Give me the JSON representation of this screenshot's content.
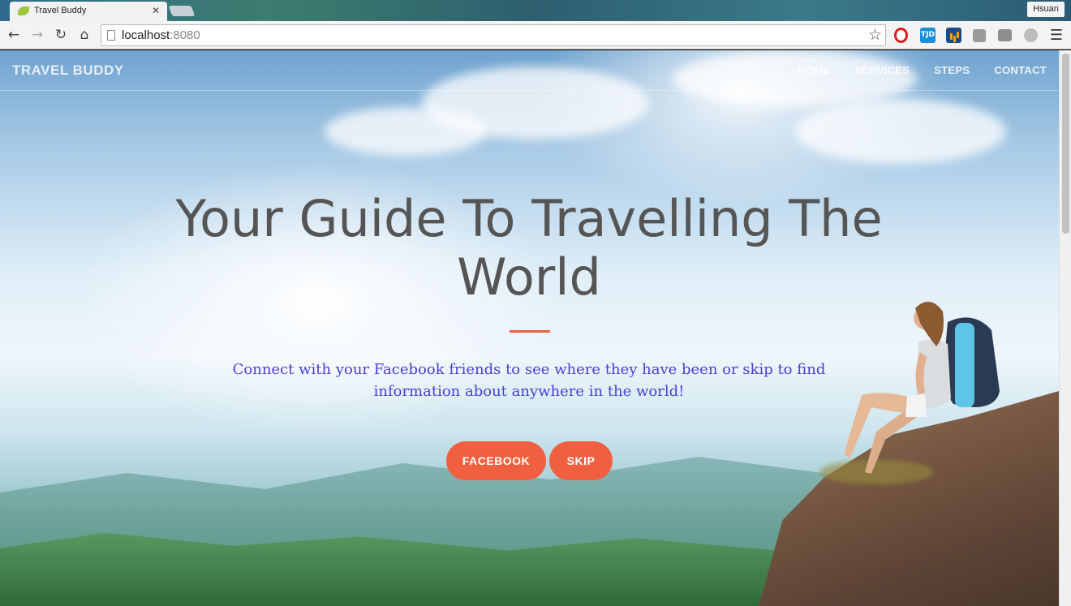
{
  "browser": {
    "tab_title": "Travel Buddy",
    "tab_close": "✕",
    "profile_name": "Hsuan",
    "url_host": "localhost",
    "url_port": ":8080",
    "icons": {
      "back": "back-arrow-icon",
      "forward": "forward-arrow-icon",
      "reload": "reload-icon",
      "home": "home-icon",
      "bookmark": "star-icon",
      "menu": "hamburger-menu-icon"
    },
    "extensions": [
      "opera-icon",
      "TJD",
      "chart-icon",
      "extension-icon",
      "extension-icon",
      "extension-icon"
    ]
  },
  "site": {
    "brand": "TRAVEL BUDDY",
    "nav": [
      "HOME",
      "SERVICES",
      "STEPS",
      "CONTACT"
    ]
  },
  "hero": {
    "title": "Your Guide To Travelling The World",
    "subtitle": "Connect with your Facebook friends to see where they have been or skip to find information about anywhere in the world!",
    "buttons": {
      "facebook": "FACEBOOK",
      "skip": "SKIP"
    }
  },
  "colors": {
    "accent": "#f05f40",
    "subtitle_text": "#4a3fd6",
    "title_text": "#555555"
  }
}
